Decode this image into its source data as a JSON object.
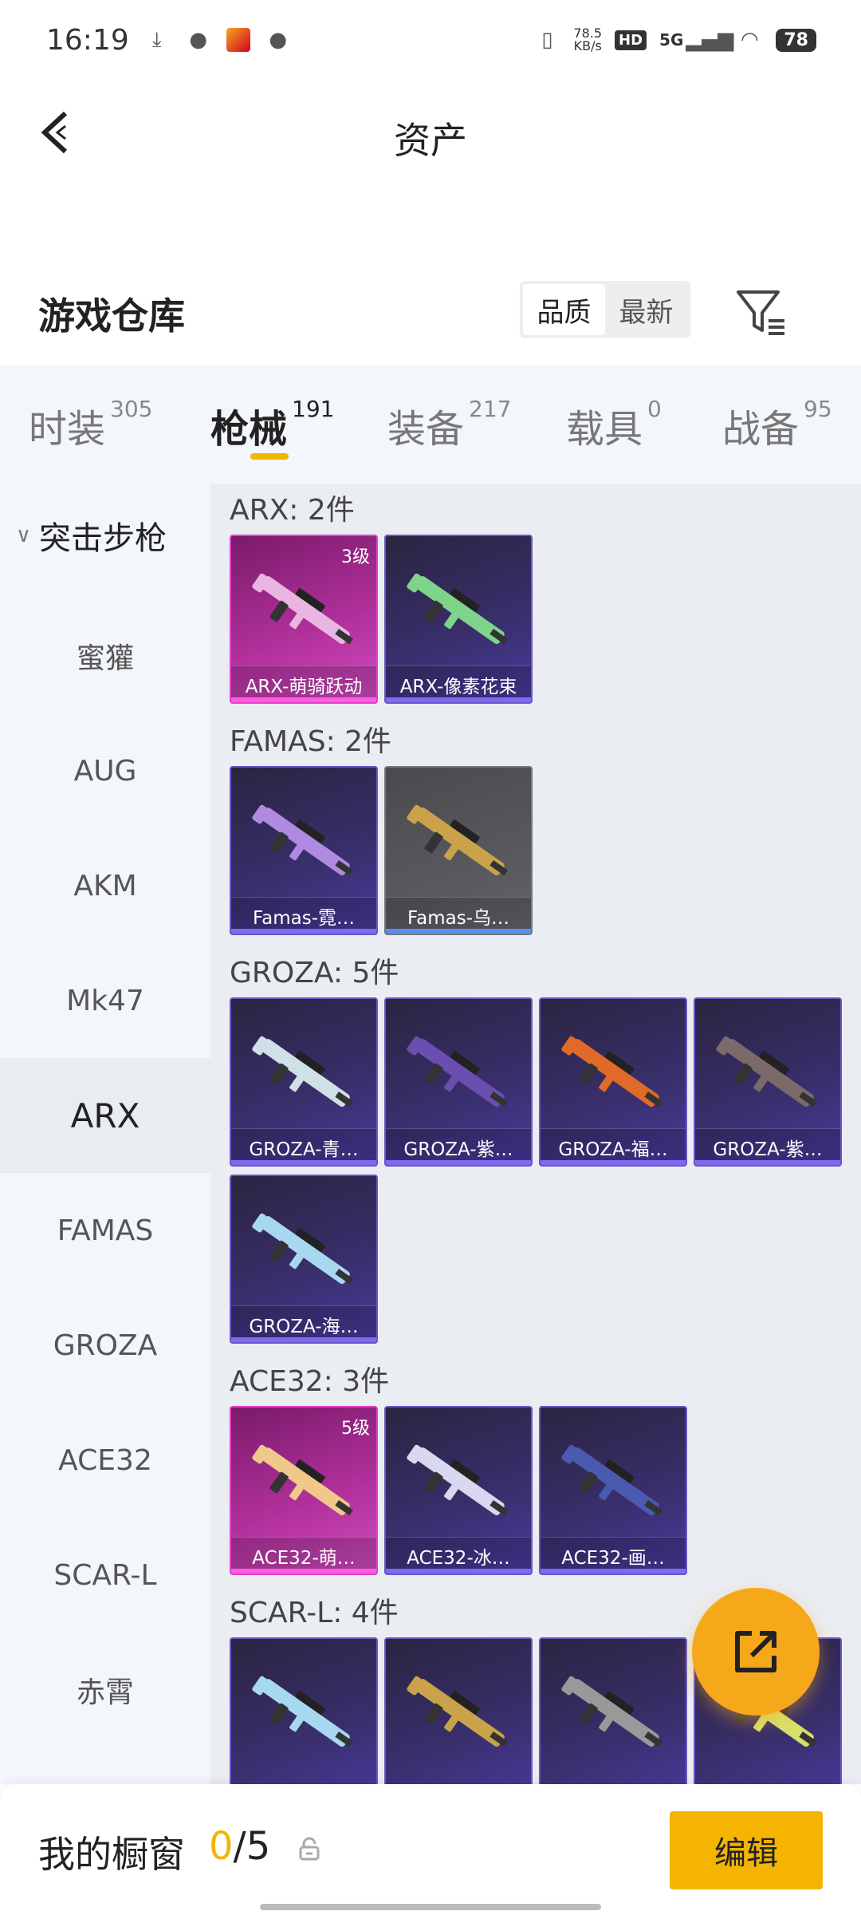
{
  "status_bar": {
    "time": "16:19",
    "speed_top": "78.5",
    "speed_unit": "KB/s",
    "hd": "HD",
    "network": "5G",
    "battery": "78"
  },
  "header": {
    "title": "资产"
  },
  "warehouse": {
    "title": "游戏仓库",
    "sort_options": [
      "品质",
      "最新"
    ],
    "active_sort": "品质"
  },
  "tabs": [
    {
      "label": "时装",
      "count": "305"
    },
    {
      "label": "枪械",
      "count": "191"
    },
    {
      "label": "装备",
      "count": "217"
    },
    {
      "label": "载具",
      "count": "0"
    },
    {
      "label": "战备",
      "count": "95"
    }
  ],
  "sidebar": {
    "category": "突击步枪",
    "items": [
      "蜜獾",
      "AUG",
      "AKM",
      "Mk47",
      "ARX",
      "FAMAS",
      "GROZA",
      "ACE32",
      "SCAR-L",
      "赤霄"
    ],
    "active": "ARX"
  },
  "groups": [
    {
      "title": "ARX: 2件",
      "cards": [
        {
          "name": "ARX-萌骑跃动",
          "level": "3级",
          "rarity": "pink",
          "gun_color": "#e8b6e0"
        },
        {
          "name": "ARX-像素花束",
          "level": "",
          "rarity": "purple",
          "gun_color": "#7fd38a"
        }
      ]
    },
    {
      "title": "FAMAS: 2件",
      "cards": [
        {
          "name": "Famas-霓…",
          "level": "",
          "rarity": "purple",
          "gun_color": "#b08ae0"
        },
        {
          "name": "Famas-乌…",
          "level": "",
          "rarity": "grey",
          "gun_color": "#c9a24a"
        }
      ]
    },
    {
      "title": "GROZA: 5件",
      "cards": [
        {
          "name": "GROZA-青…",
          "level": "",
          "rarity": "purple",
          "gun_color": "#cfe0e6"
        },
        {
          "name": "GROZA-紫…",
          "level": "",
          "rarity": "purple",
          "gun_color": "#6a4fb0"
        },
        {
          "name": "GROZA-福…",
          "level": "",
          "rarity": "purple",
          "gun_color": "#e06a2a"
        },
        {
          "name": "GROZA-紫…",
          "level": "",
          "rarity": "purple",
          "gun_color": "#7a6a6a"
        },
        {
          "name": "GROZA-海…",
          "level": "",
          "rarity": "purple",
          "gun_color": "#a8d8f0"
        }
      ]
    },
    {
      "title": "ACE32: 3件",
      "cards": [
        {
          "name": "ACE32-萌…",
          "level": "5级",
          "rarity": "pink",
          "gun_color": "#f0c88a"
        },
        {
          "name": "ACE32-冰…",
          "level": "",
          "rarity": "purple",
          "gun_color": "#d8d8f0"
        },
        {
          "name": "ACE32-画…",
          "level": "",
          "rarity": "purple",
          "gun_color": "#4a5ab0"
        }
      ]
    },
    {
      "title": "SCAR-L: 4件",
      "cards": [
        {
          "name": "",
          "level": "",
          "rarity": "purple",
          "gun_color": "#a8d8f0"
        },
        {
          "name": "",
          "level": "",
          "rarity": "purple",
          "gun_color": "#c9a24a"
        },
        {
          "name": "",
          "level": "",
          "rarity": "purple",
          "gun_color": "#999999"
        },
        {
          "name": "",
          "level": "",
          "rarity": "purple",
          "gun_color": "#d8e06a"
        }
      ]
    }
  ],
  "bottom_bar": {
    "label": "我的橱窗",
    "current": "0",
    "total": "/5",
    "edit_label": "编辑"
  },
  "colors": {
    "accent": "#f5b400",
    "fab": "#f6a81b",
    "rarity_purple": "#6a55c8",
    "rarity_pink": "#e040c8"
  }
}
